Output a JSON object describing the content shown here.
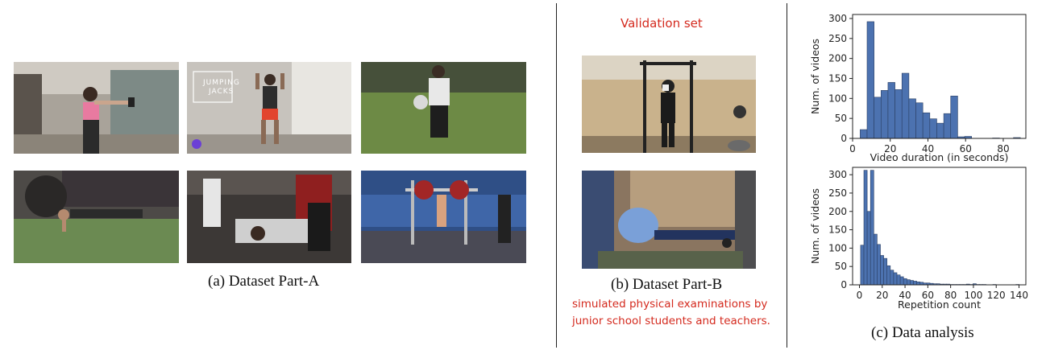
{
  "part_a": {
    "caption": "(a) Dataset Part-A"
  },
  "part_b": {
    "header": "Validation set",
    "caption": "(b) Dataset Part-B",
    "note_line1": "simulated physical examinations by",
    "note_line2": "junior school students and teachers."
  },
  "part_c": {
    "caption": "(c) Data analysis"
  },
  "thumbnail": {
    "overlay_line1": "JUMPING",
    "overlay_line2": "JACKS"
  },
  "colors": {
    "bar_fill": "#4c72b0",
    "bar_edge": "#2b3f63",
    "accent_red": "#d42a1e"
  },
  "chart_data": [
    {
      "type": "bar",
      "xlabel": "Video duration (in seconds)",
      "ylabel": "Num. of videos",
      "xlim": [
        0,
        92
      ],
      "ylim": [
        0,
        310
      ],
      "xticks": [
        0,
        20,
        40,
        60,
        80
      ],
      "yticks": [
        0,
        50,
        100,
        150,
        200,
        250,
        300
      ],
      "bin_width": 3.7,
      "bin_starts": [
        4,
        7.7,
        11.4,
        15.1,
        18.8,
        22.5,
        26.2,
        29.9,
        33.6,
        37.3,
        41,
        44.7,
        48.4,
        52.1,
        55.8,
        59.5,
        63.2,
        66.9,
        70.6,
        74.3,
        78,
        81.7,
        85.4
      ],
      "values": [
        22,
        292,
        103,
        120,
        140,
        122,
        163,
        99,
        89,
        64,
        49,
        38,
        62,
        106,
        4,
        5,
        0,
        0,
        0,
        1,
        0,
        0,
        2
      ]
    },
    {
      "type": "bar",
      "xlabel": "Repetition count",
      "ylabel": "Num. of videos",
      "xlim": [
        -6,
        146
      ],
      "ylim": [
        0,
        320
      ],
      "xticks": [
        0,
        20,
        40,
        60,
        80,
        100,
        120,
        140
      ],
      "yticks": [
        0,
        50,
        100,
        150,
        200,
        250,
        300
      ],
      "bin_width": 2.9,
      "bin_starts": [
        1,
        3.9,
        6.8,
        9.7,
        12.6,
        15.5,
        18.4,
        21.3,
        24.2,
        27.1,
        30,
        32.9,
        35.8,
        38.7,
        41.6,
        44.5,
        47.4,
        50.3,
        53.2,
        56.1,
        59,
        61.9,
        64.8,
        67.7,
        70.6,
        73.5,
        76.4,
        79.3,
        82.2,
        85.1,
        88,
        90.9,
        93.8,
        96.7,
        99.6,
        102.5,
        105.4,
        108.3,
        111.2,
        114.1,
        117,
        119.9,
        122.8,
        125.7,
        128.6,
        131.5,
        134.4,
        137.3
      ],
      "values": [
        108,
        312,
        200,
        312,
        138,
        110,
        80,
        72,
        52,
        40,
        33,
        27,
        22,
        17,
        14,
        12,
        10,
        8,
        7,
        5,
        5,
        4,
        3,
        3,
        2,
        2,
        2,
        1,
        1,
        1,
        1,
        1,
        2,
        1,
        3,
        1,
        1,
        1,
        0,
        0,
        1,
        0,
        0,
        0,
        0,
        0,
        0,
        1
      ]
    }
  ]
}
